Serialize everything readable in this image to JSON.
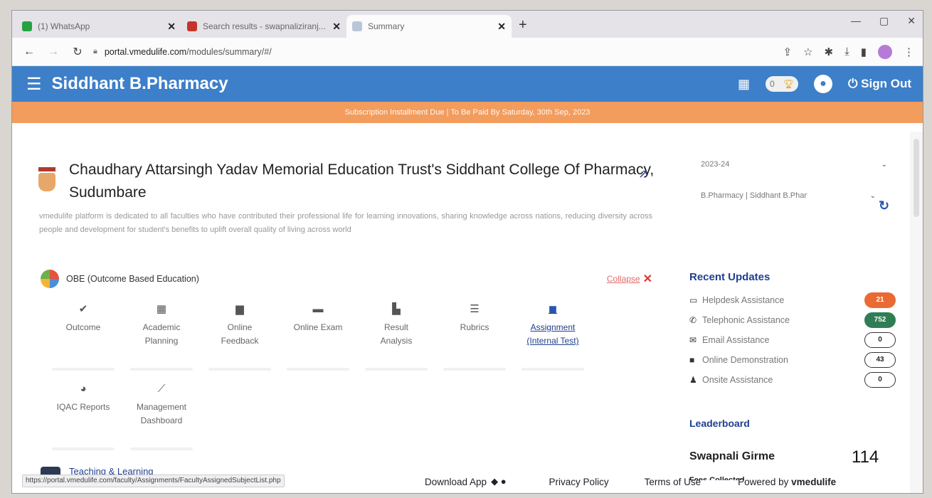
{
  "browser": {
    "tabs": [
      {
        "title": "(1) WhatsApp",
        "favicon_color": "#25a243"
      },
      {
        "title": "Search results - swapnaliziranj...",
        "favicon_color": "#c5342c"
      },
      {
        "title": "Summary",
        "favicon_color": "#b9c6d8"
      }
    ],
    "url_host": "portal.vmedulife.com",
    "url_path": "/modules/summary/#/"
  },
  "app": {
    "brand": "Siddhant B.Pharmacy",
    "trophy_count": "0",
    "sign_out": "Sign Out",
    "banner": "Subscription Installment Due | To Be Paid By Saturday, 30th Sep, 2023"
  },
  "college": {
    "name": "Chaudhary Attarsingh Yadav Memorial Education Trust's Siddhant College Of Pharmacy, Sudumbare",
    "description": "vmedulife platform is dedicated to all faculties who have contributed their professional life for learning innovations, sharing knowledge across nations, reducing diversity across people and development for student's benefits to uplift overall quality of living across world"
  },
  "filters": {
    "year": "2023-24",
    "program": "B.Pharmacy | Siddhant B.Phar"
  },
  "obe": {
    "title": "OBE (Outcome Based Education)",
    "collapse": "Collapse",
    "tiles": [
      {
        "label": "Outcome",
        "icon": "check-icon"
      },
      {
        "label": "Academic Planning",
        "icon": "calendar-icon"
      },
      {
        "label": "Online Feedback",
        "icon": "comment-icon"
      },
      {
        "label": "Online Exam",
        "icon": "folder-icon"
      },
      {
        "label": "Result Analysis",
        "icon": "bar-chart-icon"
      },
      {
        "label": "Rubrics",
        "icon": "list-icon"
      },
      {
        "label": "Assignment (Internal Test)",
        "icon": "book-icon"
      },
      {
        "label": "IQAC Reports",
        "icon": "pie-chart-icon"
      },
      {
        "label": "Management Dashboard",
        "icon": "line-chart-icon"
      }
    ]
  },
  "teaching": {
    "title": "Teaching & Learning"
  },
  "recent_updates": {
    "title": "Recent Updates",
    "items": [
      {
        "label": "Helpdesk Assistance",
        "count": "21",
        "icon": "monitor-icon"
      },
      {
        "label": "Telephonic Assistance",
        "count": "752",
        "icon": "phone-icon"
      },
      {
        "label": "Email Assistance",
        "count": "0",
        "icon": "envelope-icon"
      },
      {
        "label": "Online Demonstration",
        "count": "43",
        "icon": "video-icon"
      },
      {
        "label": "Onsite Assistance",
        "count": "0",
        "icon": "user-check-icon"
      }
    ]
  },
  "leaderboard": {
    "title": "Leaderboard",
    "name": "Swapnali Girme",
    "score": "114",
    "fees_label": "Fees Collected"
  },
  "status_url": "https://portal.vmedulife.com/faculty/Assignments/FacultyAssignedSubjectList.php",
  "footer": {
    "download_app": "Download App",
    "privacy": "Privacy Policy",
    "terms": "Terms of Use",
    "powered_by": "Powered by",
    "powered_brand": "vmedulife"
  }
}
